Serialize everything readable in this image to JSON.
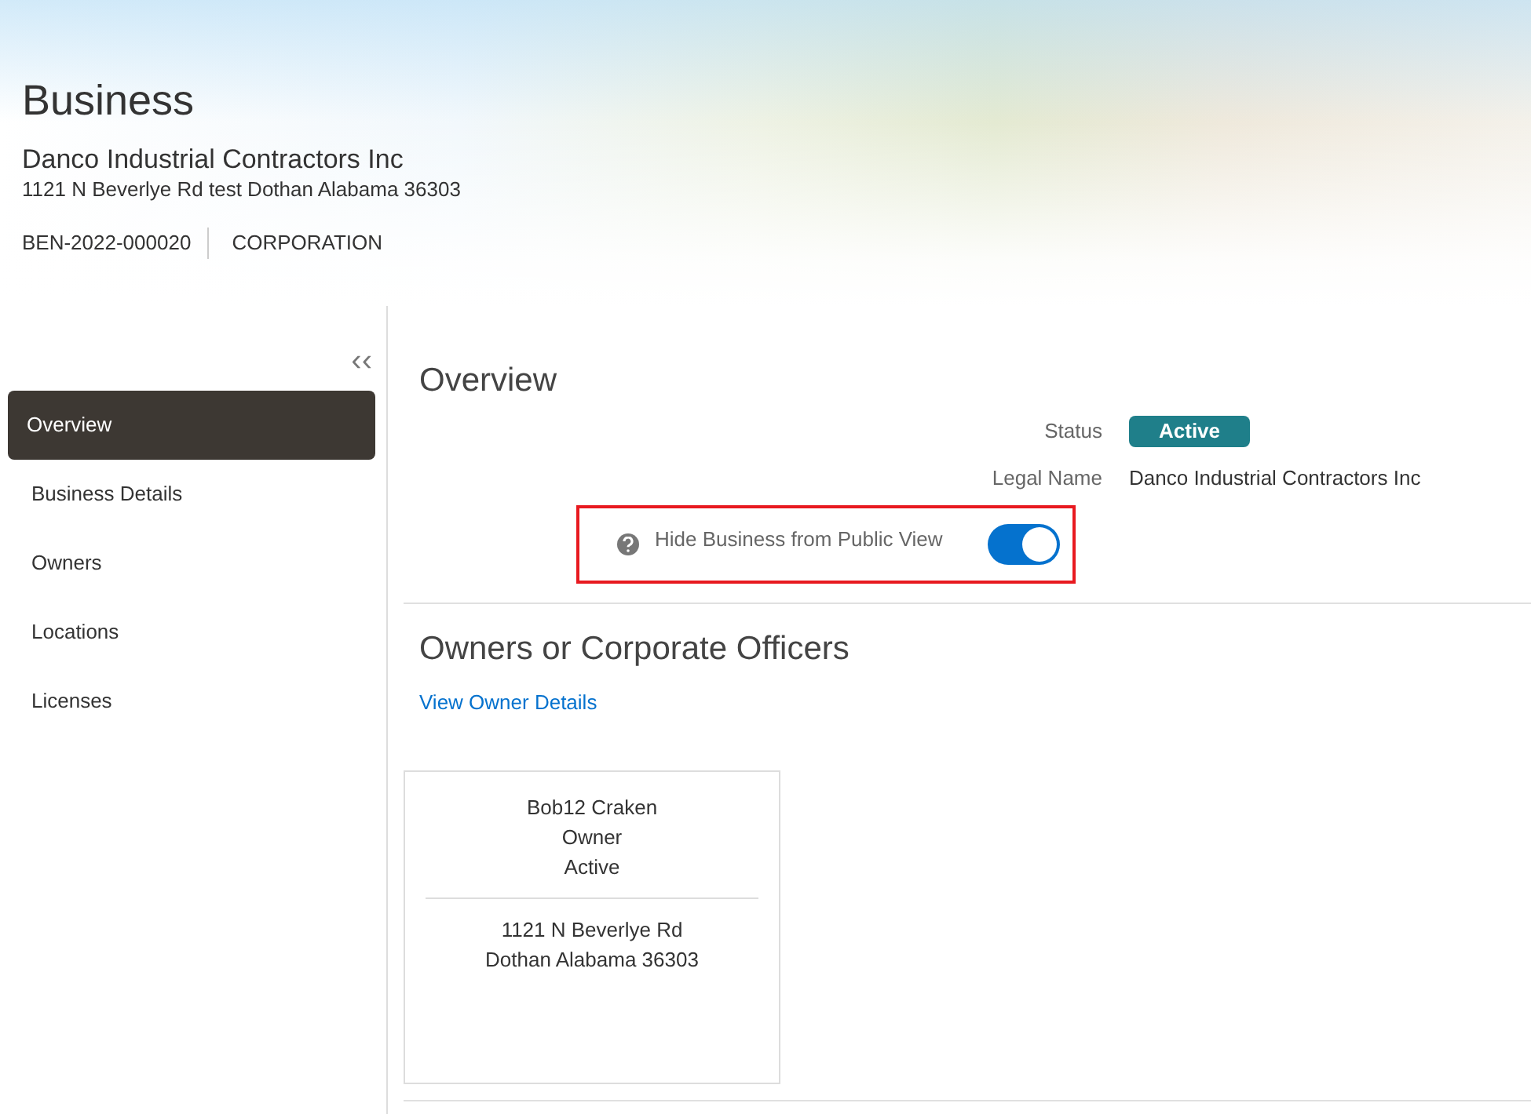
{
  "header": {
    "title": "Business",
    "business_name": "Danco Industrial Contractors Inc",
    "address": "1121 N Beverlye Rd test Dothan Alabama 36303",
    "id": "BEN-2022-000020",
    "type": "CORPORATION"
  },
  "sidebar": {
    "collapse": "‹‹",
    "items": [
      {
        "label": "Overview",
        "selected": true
      },
      {
        "label": "Business Details",
        "selected": false
      },
      {
        "label": "Owners",
        "selected": false
      },
      {
        "label": "Locations",
        "selected": false
      },
      {
        "label": "Licenses",
        "selected": false
      }
    ]
  },
  "overview": {
    "title": "Overview",
    "fields": [
      {
        "label": "Status",
        "value": "Active",
        "kind": "badge"
      },
      {
        "label": "Legal Name",
        "value": "Danco Industrial Contractors Inc",
        "kind": "text"
      }
    ],
    "toggle": {
      "label": "Hide Business from Public View",
      "on": true,
      "highlighted": true
    }
  },
  "owners": {
    "title": "Owners or Corporate Officers",
    "link": "View Owner Details",
    "cards": [
      {
        "name": "Bob12 Craken",
        "role": "Owner",
        "status": "Active",
        "address_line_1": "1121 N Beverlye Rd",
        "address_line_2": "Dothan Alabama 36303"
      }
    ]
  }
}
